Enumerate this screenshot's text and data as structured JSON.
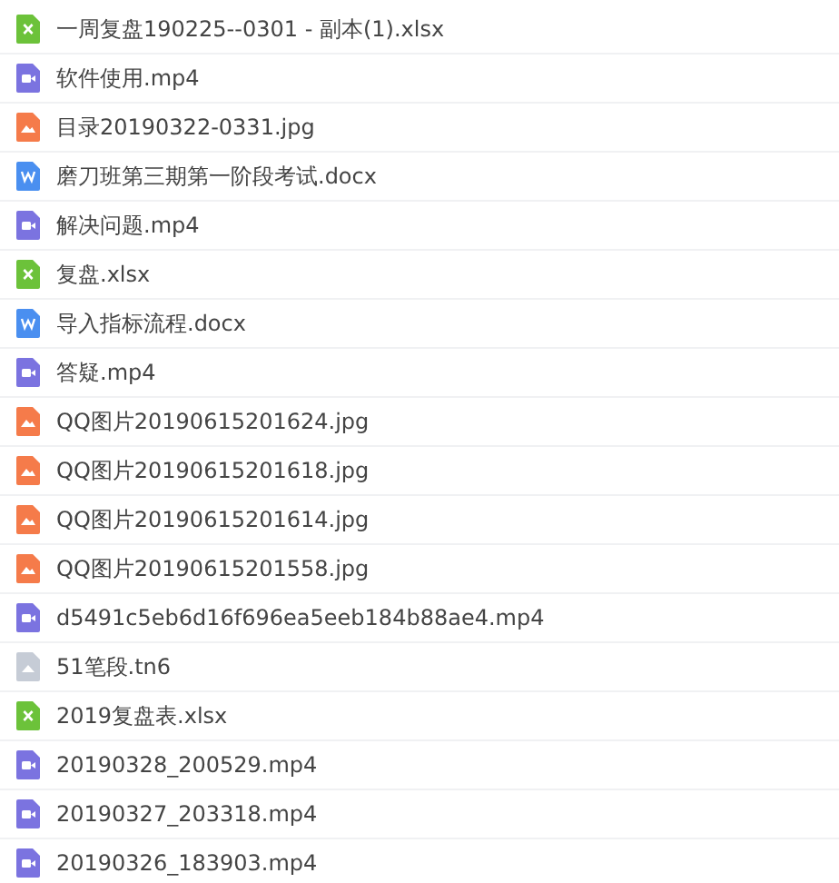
{
  "files": [
    {
      "kind": "excel",
      "name": "一周复盘190225--0301 - 副本(1).xlsx"
    },
    {
      "kind": "video",
      "name": "软件使用.mp4"
    },
    {
      "kind": "image",
      "name": "目录20190322-0331.jpg"
    },
    {
      "kind": "word",
      "name": "磨刀班第三期第一阶段考试.docx"
    },
    {
      "kind": "video",
      "name": "解决问题.mp4"
    },
    {
      "kind": "excel",
      "name": "复盘.xlsx"
    },
    {
      "kind": "word",
      "name": "导入指标流程.docx"
    },
    {
      "kind": "video",
      "name": "答疑.mp4"
    },
    {
      "kind": "image",
      "name": "QQ图片20190615201624.jpg"
    },
    {
      "kind": "image",
      "name": "QQ图片20190615201618.jpg"
    },
    {
      "kind": "image",
      "name": "QQ图片20190615201614.jpg"
    },
    {
      "kind": "image",
      "name": "QQ图片20190615201558.jpg"
    },
    {
      "kind": "video",
      "name": "d5491c5eb6d16f696ea5eeb184b88ae4.mp4"
    },
    {
      "kind": "other",
      "name": "51笔段.tn6"
    },
    {
      "kind": "excel",
      "name": "2019复盘表.xlsx"
    },
    {
      "kind": "video",
      "name": "20190328_200529.mp4"
    },
    {
      "kind": "video",
      "name": "20190327_203318.mp4"
    },
    {
      "kind": "video",
      "name": "20190326_183903.mp4"
    }
  ]
}
